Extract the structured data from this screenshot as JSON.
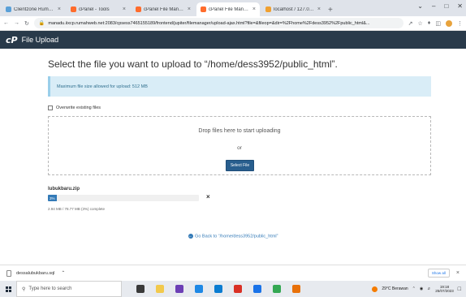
{
  "browser": {
    "tabs": [
      {
        "title": "Clientzone Rumahweb",
        "favicon_color": "#5aa0d8",
        "active": false
      },
      {
        "title": "cPanel - Tools",
        "favicon_color": "#ff6c2c",
        "active": false
      },
      {
        "title": "cPanel File Manager v3",
        "favicon_color": "#ff6c2c",
        "active": false
      },
      {
        "title": "cPanel File Manager v3 - File",
        "favicon_color": "#ff6c2c",
        "active": true
      },
      {
        "title": "localhost / 127.0.0.1 / dessalu",
        "favicon_color": "#f0a030",
        "active": false
      }
    ],
    "new_tab": "+",
    "url": "manadu.iixcp.rumahweb.net:2083/cpsess7465155189/frontend/jupiter/filemanager/upload-ajax.html?file=&fileop=&dir=%2Fhome%2Fdess3952%2Fpublic_html&..."
  },
  "header": {
    "logo": "cP",
    "title": "File Upload"
  },
  "main": {
    "heading": "Select the file you want to upload to “/home/dess3952/public_html”.",
    "alert": "Maximum file size allowed for upload: 512 MB",
    "overwrite_label": "Overwrite existing files",
    "dropzone_text": "Drop files here to start uploading",
    "or_text": "or",
    "select_button": "Select File",
    "upload": {
      "filename": "lubukbaru.zip",
      "percent_label": "3%",
      "percent": 3,
      "status": "2.94 MB / 78.77 MB (3%) complete",
      "cancel": "×"
    },
    "go_back": "Go Back to “/home/dess3952/public_html”"
  },
  "downloads": {
    "file": "dessalubukbaru.sql",
    "show_all": "Show all",
    "close": "×"
  },
  "taskbar": {
    "search_placeholder": "Type here to search",
    "weather": "29°C  Berawan",
    "time": "19:18",
    "date": "25/07/2023",
    "icon_colors": [
      "#3a3a3a",
      "#f2c94c",
      "#6c3fb5",
      "#1e88e5",
      "#0a7cd1",
      "#d93025",
      "#1a73e8",
      "#34a853",
      "#e8710a"
    ]
  },
  "colors": {
    "cpanel_header": "#293a4a",
    "accent": "#337ab7",
    "alert_bg": "#d9edf7"
  }
}
